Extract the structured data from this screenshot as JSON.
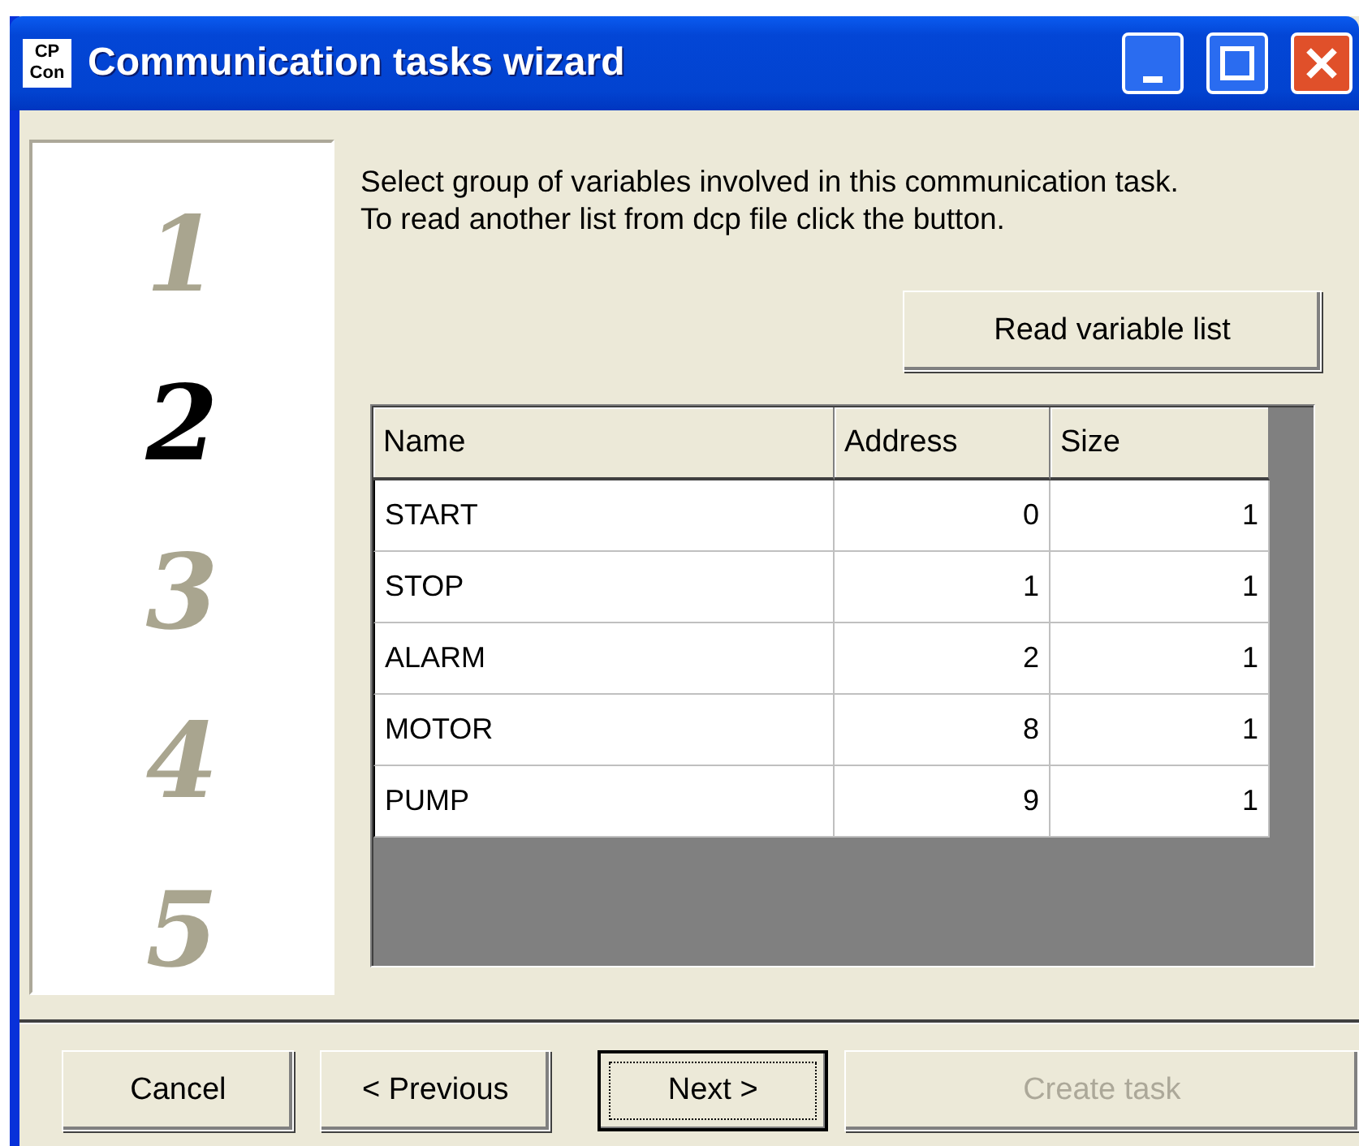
{
  "window": {
    "title": "Communication tasks wizard",
    "app_icon": "CP Con"
  },
  "steps": [
    {
      "label": "1",
      "selected": false
    },
    {
      "label": "2",
      "selected": true
    },
    {
      "label": "3",
      "selected": false
    },
    {
      "label": "4",
      "selected": false
    },
    {
      "label": "5",
      "selected": false
    }
  ],
  "instructions": "Select group of variables involved in this communication task. To read another list from dcp file click the button.",
  "read_button": "Read variable list",
  "table": {
    "columns": [
      "Name",
      "Address",
      "Size"
    ],
    "rows": [
      [
        "START",
        "0",
        "1"
      ],
      [
        "STOP",
        "1",
        "1"
      ],
      [
        "ALARM",
        "2",
        "1"
      ],
      [
        "MOTOR",
        "8",
        "1"
      ],
      [
        "PUMP",
        "9",
        "1"
      ]
    ]
  },
  "buttons": [
    {
      "label": "Cancel",
      "disabled": false,
      "default": false
    },
    {
      "label": "< Previous",
      "disabled": false,
      "default": false
    },
    {
      "label": "Next >",
      "disabled": false,
      "default": true
    },
    {
      "label": "Create task",
      "disabled": true,
      "default": false
    }
  ]
}
